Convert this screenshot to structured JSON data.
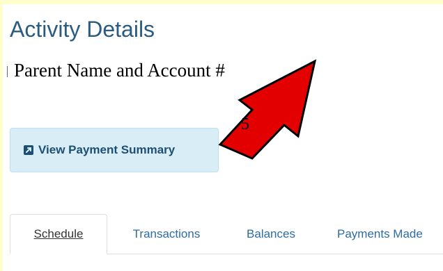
{
  "page": {
    "title": "Activity Details",
    "parent_label": "Parent Name and Account #"
  },
  "payment_button": {
    "label": "View Payment Summary",
    "icon": "external-link-icon"
  },
  "annotation": {
    "number": "5",
    "color": "#e30000"
  },
  "tabs": [
    {
      "label": "Schedule",
      "active": true
    },
    {
      "label": "Transactions",
      "active": false
    },
    {
      "label": "Balances",
      "active": false
    },
    {
      "label": "Payments Made",
      "active": false
    }
  ],
  "colors": {
    "frame": "#ffffcc",
    "title": "#2a5b80",
    "button_bg": "#d9edf7",
    "button_text": "#1d4f73",
    "tab_link": "#2d6ca2"
  }
}
